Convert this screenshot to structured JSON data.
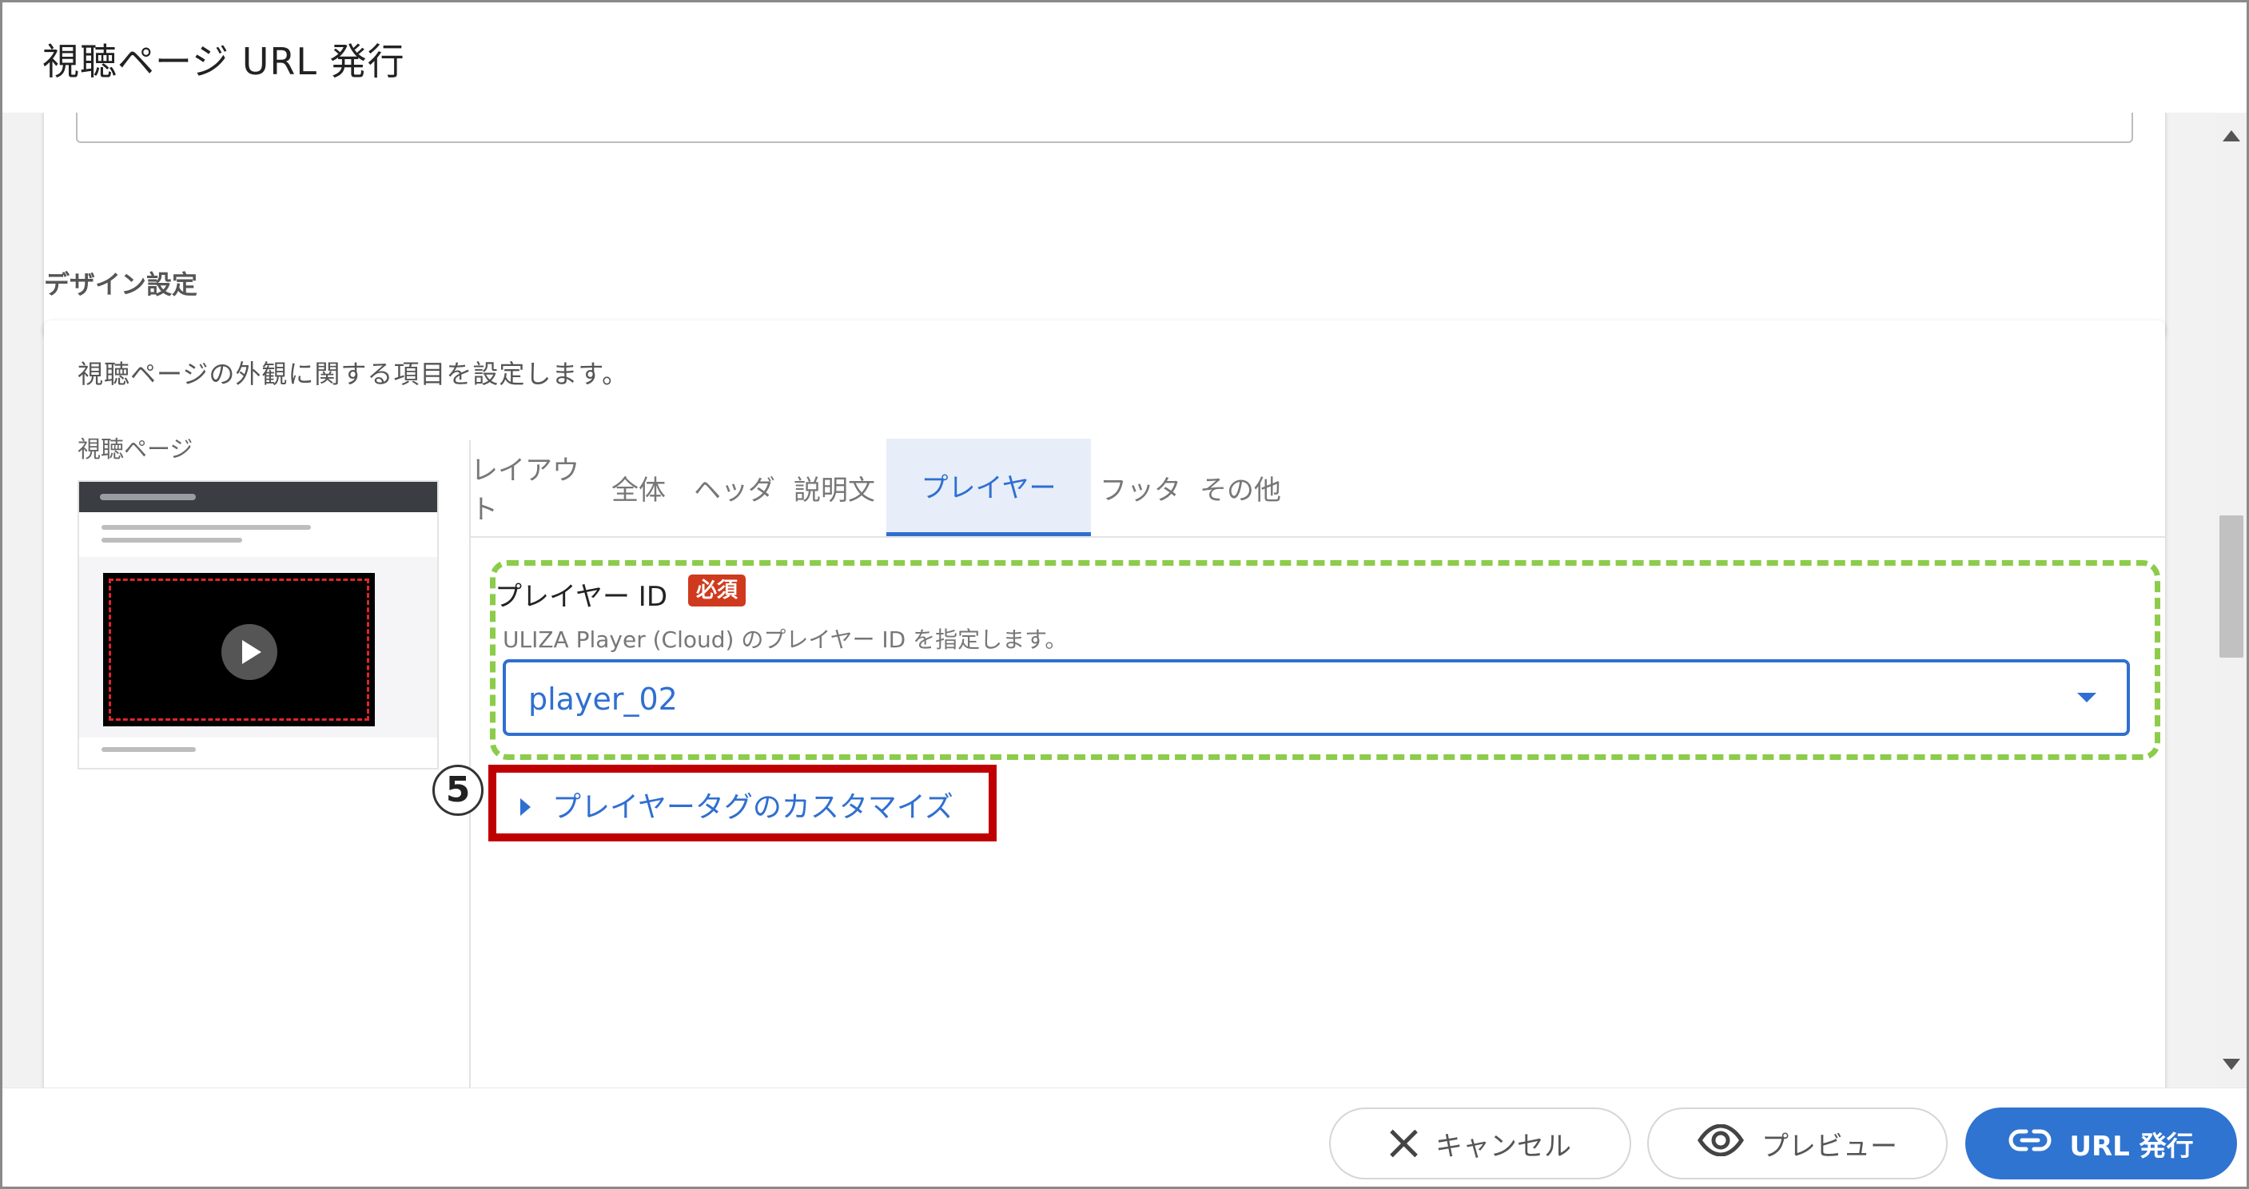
{
  "dialog": {
    "title": "視聴ページ URL 発行"
  },
  "design_section": {
    "title": "デザイン設定",
    "description": "視聴ページの外観に関する項目を設定します。",
    "thumbnail_label": "視聴ページ"
  },
  "tabs": [
    {
      "label": "レイアウト",
      "active": false
    },
    {
      "label": "全体",
      "active": false
    },
    {
      "label": "ヘッダ",
      "active": false
    },
    {
      "label": "説明文",
      "active": false
    },
    {
      "label": "プレイヤー",
      "active": true
    },
    {
      "label": "フッタ",
      "active": false
    },
    {
      "label": "その他",
      "active": false
    }
  ],
  "player_field": {
    "label": "プレイヤー ID",
    "required_badge": "必須",
    "help": "ULIZA Player (Cloud) のプレイヤー ID を指定します。",
    "selected_value": "player_02",
    "caret_icon": "caret-down-icon"
  },
  "customize": {
    "step_number": "5",
    "label": "プレイヤータグのカスタマイズ",
    "caret_icon": "caret-right-icon"
  },
  "footer": {
    "cancel_label": "キャンセル",
    "cancel_icon": "close-icon",
    "preview_label": "プレビュー",
    "preview_icon": "eye-icon",
    "issue_label": "URL 発行",
    "issue_icon": "link-icon"
  },
  "colors": {
    "primary": "#2f74d0",
    "highlight_green": "#8ccc4b",
    "highlight_red": "#c00000",
    "required_badge": "#cf3a1e"
  }
}
